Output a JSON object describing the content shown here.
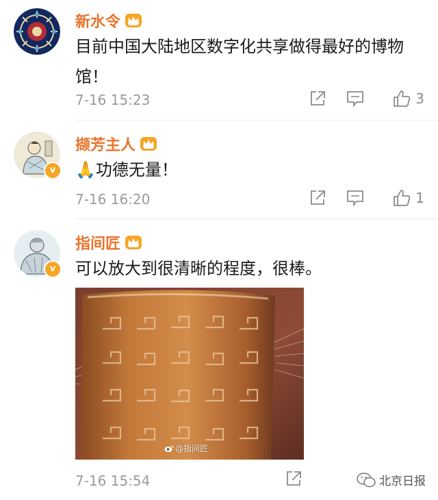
{
  "comments": [
    {
      "username": "新水令",
      "text": "目前中国大陆地区数字化共享做得最好的博物馆！",
      "time": "7-16 15:23",
      "likes": "3"
    },
    {
      "username": "撷芳主人",
      "text": "🙏功德无量！",
      "time": "7-16 16:20",
      "likes": "1"
    },
    {
      "username": "指间匠",
      "text": "可以放大到很清晰的程度，很棒。",
      "time": "7-16 15:54",
      "image_watermark": "@指间匠"
    }
  ],
  "source": "北京日报",
  "colors": {
    "username": "#e8742c",
    "crown": "#f5a623",
    "meta": "#9a9a9a",
    "divider": "#ececec"
  },
  "icons": {
    "share": "share-icon",
    "reply": "reply-icon",
    "like": "thumb-up-icon",
    "crown": "crown-icon",
    "verified": "verified-badge-icon"
  }
}
